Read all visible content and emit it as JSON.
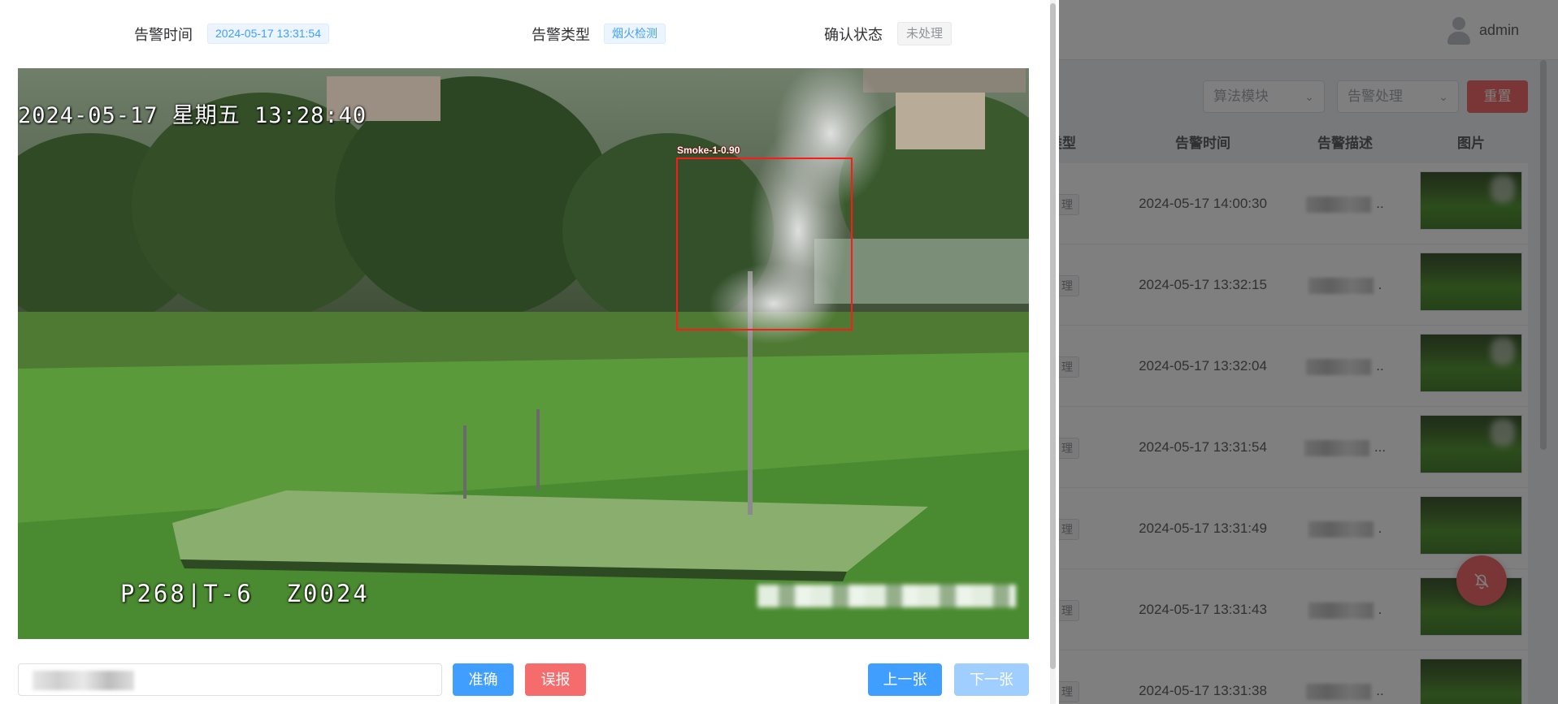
{
  "background_page": {
    "user_name": "admin",
    "filters": {
      "algorithm_placeholder": "算法模块",
      "handling_placeholder": "告警处理",
      "reset_label": "重置"
    },
    "table": {
      "columns": [
        "类型",
        "告警时间",
        "告警描述",
        "图片"
      ],
      "rows": [
        {
          "type": "理",
          "time": "2024-05-17 14:00:30",
          "desc_suffix": ".."
        },
        {
          "type": "理",
          "time": "2024-05-17 13:32:15",
          "desc_suffix": "."
        },
        {
          "type": "理",
          "time": "2024-05-17 13:32:04",
          "desc_suffix": ".."
        },
        {
          "type": "理",
          "time": "2024-05-17 13:31:54",
          "desc_suffix": "..."
        },
        {
          "type": "理",
          "time": "2024-05-17 13:31:49",
          "desc_suffix": "."
        },
        {
          "type": "理",
          "time": "2024-05-17 13:31:43",
          "desc_suffix": "."
        },
        {
          "type": "理",
          "time": "2024-05-17 13:31:38",
          "desc_suffix": ".."
        }
      ]
    },
    "icons": {
      "avatar": "user-avatar-icon",
      "select_arrow": "chevron-down-icon",
      "float": "bell-off-icon"
    }
  },
  "dialog": {
    "meta": {
      "time_label": "告警时间",
      "time_value": "2024-05-17 13:31:54",
      "type_label": "告警类型",
      "type_value": "烟火检测",
      "status_label": "确认状态",
      "status_value": "未处理"
    },
    "image": {
      "osd_datetime": "2024-05-17 星期五 13:28:40",
      "osd_camera": "P268|T-6  Z0024",
      "detection_label": "Smoke-1-0.90"
    },
    "actions": {
      "remark_placeholder": "",
      "accurate_label": "准确",
      "false_label": "误报",
      "prev_label": "上一张",
      "next_label": "下一张"
    }
  },
  "colors": {
    "primary": "#409eff",
    "primary_disabled": "#a0cfff",
    "danger": "#f56c6c",
    "detection_box": "#ff1a1a"
  }
}
